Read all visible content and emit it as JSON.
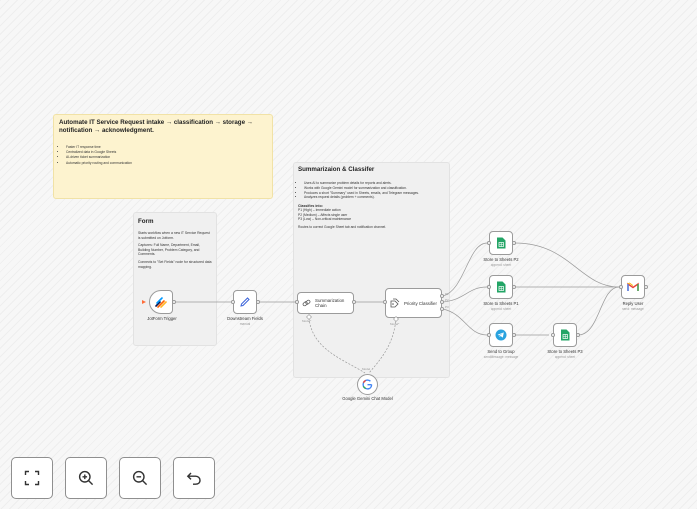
{
  "sticky_main": {
    "title": "Automate IT Service Request intake → classification → storage → notification → acknowledgment.",
    "bullets": [
      "Faster IT response time",
      "Centralized data in Google Sheets",
      "AI-driven ticket summarization",
      "Automatic priority routing and communication"
    ]
  },
  "sticky_form": {
    "title": "Form",
    "p1": "Starts workflow when a new IT Service Request is submitted on Jotform.",
    "p2": "Captures: Full Name, Department, Email, Building Number, Problem Category, and Comments.",
    "p3": "Connects to \"Set Fields\" node for structured data mapping."
  },
  "sticky_summarize": {
    "title": "Summarizaion & Classifer",
    "bullets": [
      "Uses AI to summarize problem details for reports and alerts.",
      "Works with Google Gemini model for summarization and classification.",
      "Produces a short \"Summary\" used in Sheets, emails, and Telegram messages.",
      "Analyzes request details (problem + comments)."
    ],
    "classifies_title": "Classifies into:",
    "classes": [
      "P1 (High) – Immediate action",
      "P2 (Medium) – Affects single user",
      "P3 (Low) – Non-critical maintenance"
    ],
    "routes": "Routes to correct Google Sheet tab and notification channel."
  },
  "nodes": {
    "jotform": {
      "label": "JotForm Trigger",
      "icon": "jotform-icon"
    },
    "fields": {
      "label": "Downstream Fields",
      "sub": "manual",
      "icon": "pencil-icon"
    },
    "summarization": {
      "label": "Summarization Chain",
      "icon": "chain-link-icon",
      "port": "Model*"
    },
    "classifier": {
      "label": "Priority Classifier",
      "icon": "classifier-icon",
      "port": "Model*"
    },
    "gemini": {
      "label": "Google Gemini Chat Model",
      "icon": "google-icon",
      "port": "Model"
    },
    "sheets_p2": {
      "label": "Store to Sheets P2",
      "sub": "append: sheet",
      "icon": "google-sheets-icon"
    },
    "sheets_p1": {
      "label": "Store to Sheets P1",
      "sub": "append: sheet",
      "icon": "google-sheets-icon"
    },
    "telegram": {
      "label": "Send to Group",
      "sub": "sendMessage: message",
      "icon": "telegram-icon"
    },
    "sheets_p3": {
      "label": "Store to Sheets P3",
      "sub": "append: sheet",
      "icon": "google-sheets-icon"
    },
    "reply": {
      "label": "Reply User",
      "sub": "send: message",
      "icon": "gmail-icon"
    }
  },
  "classifier_outputs": [
    "P1",
    "P2",
    "P3"
  ],
  "toolbar": {
    "fit": "fit-view-icon",
    "zoom_in": "zoom-in-icon",
    "zoom_out": "zoom-out-icon",
    "undo": "undo-icon"
  },
  "colors": {
    "sticky_yellow": "#fdf3cf",
    "trigger_arrow": "#ff6d3a",
    "sheets_green": "#23a566",
    "telegram_blue": "#2aa3df",
    "gmail_red": "#ea4335"
  }
}
